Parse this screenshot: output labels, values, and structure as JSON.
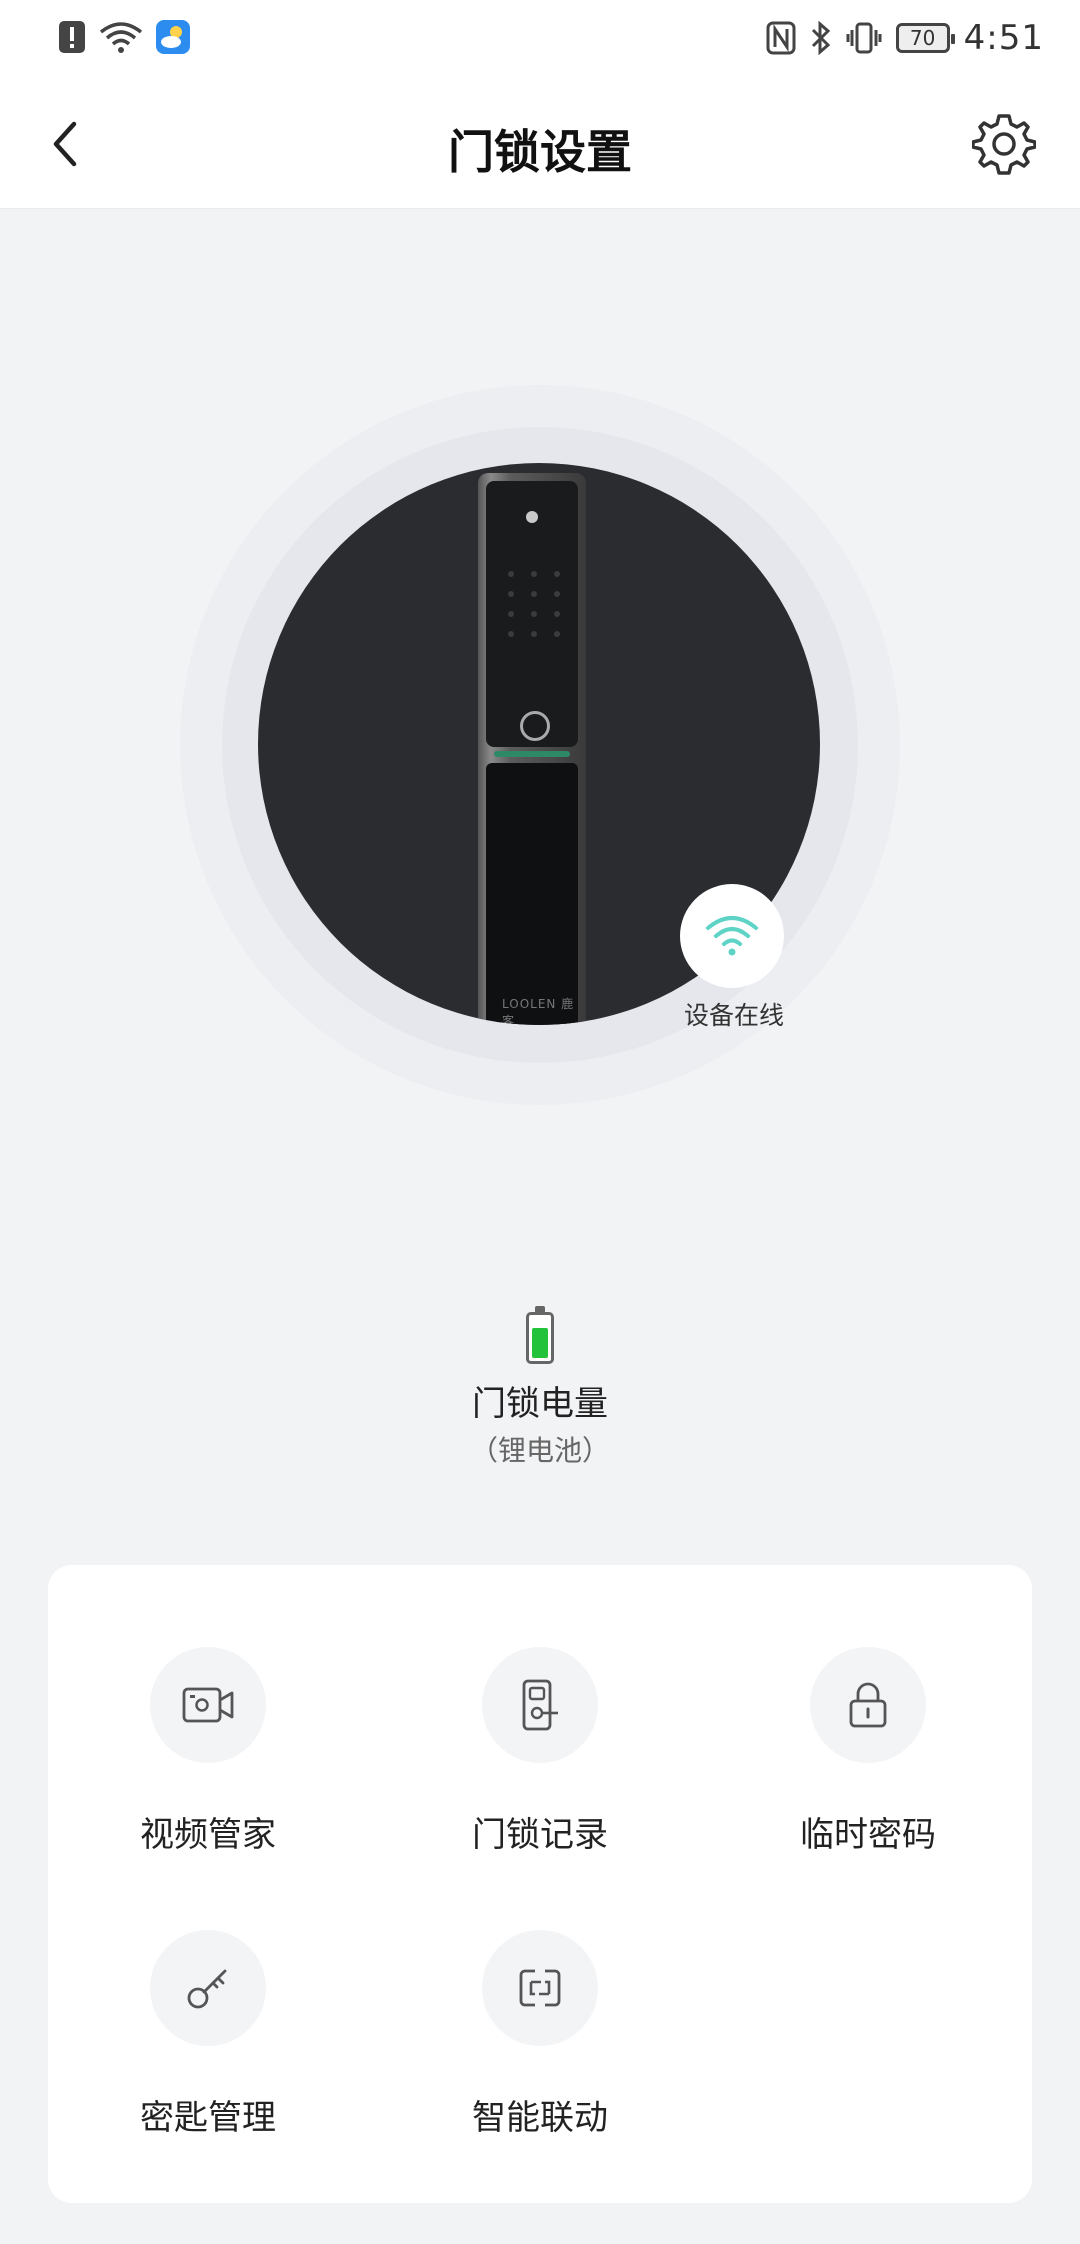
{
  "status_bar": {
    "time": "4:51",
    "battery_level": "70",
    "icons": [
      "alert-icon",
      "wifi-icon",
      "weather-icon",
      "nfc-icon",
      "bluetooth-icon",
      "vibrate-icon"
    ]
  },
  "header": {
    "title": "门锁设置",
    "back_icon": "chevron-left-icon",
    "settings_icon": "gear-icon"
  },
  "device": {
    "status_label": "设备在线",
    "status_icon": "wifi-icon",
    "status_color": "#5fd3c6",
    "brand_mark": "LOOLEN 鹿客"
  },
  "battery": {
    "title": "门锁电量",
    "subtitle": "（锂电池）",
    "fill_fraction": 0.75,
    "fill_color": "#22c33a"
  },
  "features": [
    {
      "label": "视频管家",
      "icon": "video-camera-icon"
    },
    {
      "label": "门锁记录",
      "icon": "door-lock-record-icon"
    },
    {
      "label": "临时密码",
      "icon": "padlock-icon"
    },
    {
      "label": "密匙管理",
      "icon": "key-icon"
    },
    {
      "label": "智能联动",
      "icon": "link-icon"
    }
  ]
}
